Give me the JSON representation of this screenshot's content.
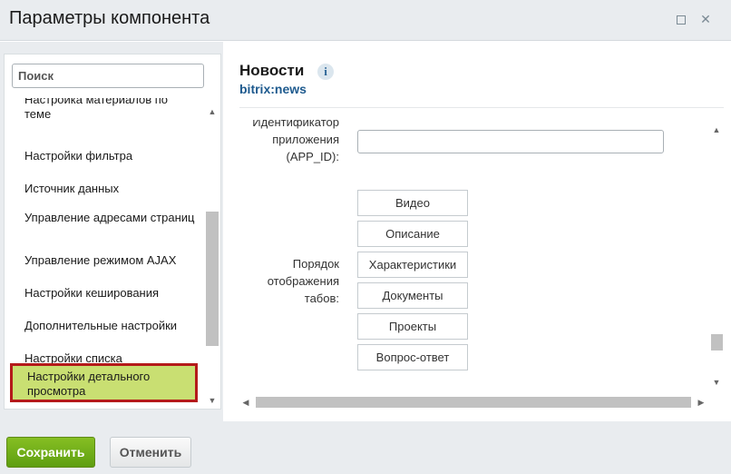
{
  "window": {
    "title": "Параметры компонента",
    "maximize_icon": "maximize-icon",
    "close_icon": "close-icon",
    "close_glyph": "✕"
  },
  "sidebar": {
    "search_placeholder": "Поиск",
    "items": [
      {
        "label": "Настройка материалов по теме"
      },
      {
        "label": "Настройки фильтра"
      },
      {
        "label": "Источник данных"
      },
      {
        "label": "Управление адресами страниц"
      },
      {
        "label": "Управление режимом AJAX"
      },
      {
        "label": "Настройки кеширования"
      },
      {
        "label": "Дополнительные настройки"
      },
      {
        "label": "Настройки списка"
      },
      {
        "label": "Настройки детального просмотра",
        "selected": true
      }
    ],
    "selected_color": "#c9df72",
    "selected_border_color": "#b41a1a"
  },
  "component": {
    "title": "Новости",
    "info_glyph": "i",
    "code": "bitrix:news"
  },
  "params": {
    "app_id_label": "Идентификатор приложения (APP_ID):",
    "app_id_value": "",
    "tabs_order_label": "Порядок отображения табов:",
    "tabs": [
      "Видео",
      "Описание",
      "Характеристики",
      "Документы",
      "Проекты",
      "Вопрос-ответ"
    ]
  },
  "footer": {
    "save_label": "Сохранить",
    "cancel_label": "Отменить"
  },
  "colors": {
    "accent_green": "#6aab16",
    "link_blue": "#1e5a8e"
  }
}
